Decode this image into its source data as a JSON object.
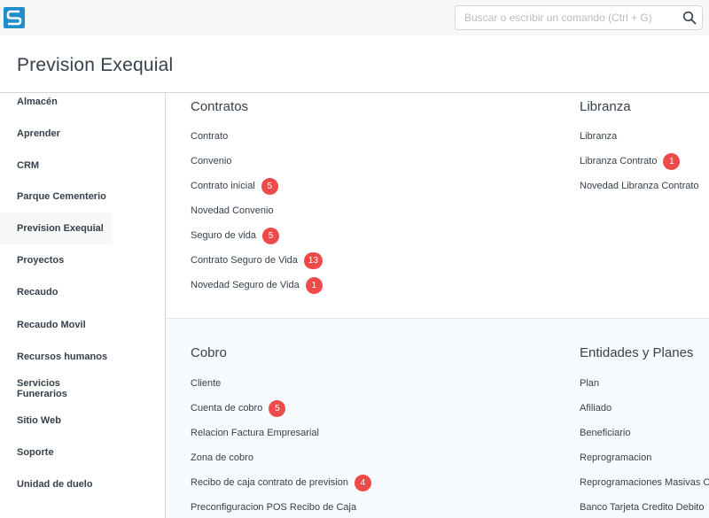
{
  "navbar": {
    "search_placeholder": "Buscar o escribir un comando (Ctrl + G)",
    "logo_icon": "app-logo-icon",
    "search_icon": "search-icon"
  },
  "page": {
    "title": "Prevision Exequial"
  },
  "sidebar": {
    "items": [
      {
        "label": "Almacén"
      },
      {
        "label": "Aprender"
      },
      {
        "label": "CRM"
      },
      {
        "label": "Parque Cementerio"
      },
      {
        "label": "Prevision Exequial"
      },
      {
        "label": "Proyectos"
      },
      {
        "label": "Recaudo"
      },
      {
        "label": "Recaudo Movil"
      },
      {
        "label": "Recursos humanos"
      },
      {
        "label": "Servicios Funerarios"
      },
      {
        "label": "Sitio Web"
      },
      {
        "label": "Soporte"
      },
      {
        "label": "Unidad de duelo"
      }
    ],
    "active": "Prevision Exequial"
  },
  "contratos": {
    "title": "Contratos",
    "links": [
      {
        "label": "Contrato",
        "badge": ""
      },
      {
        "label": "Convenio",
        "badge": ""
      },
      {
        "label": "Contrato inicial",
        "badge": "5"
      },
      {
        "label": "Novedad Convenio",
        "badge": ""
      },
      {
        "label": "Seguro de vida",
        "badge": "5"
      },
      {
        "label": "Contrato Seguro de Vida",
        "badge": "13"
      },
      {
        "label": "Novedad Seguro de Vida",
        "badge": "1"
      }
    ]
  },
  "libranza": {
    "title": "Libranza",
    "links": [
      {
        "label": "Libranza",
        "badge": ""
      },
      {
        "label": "Libranza Contrato",
        "badge": "1"
      },
      {
        "label": "Novedad Libranza Contrato",
        "badge": ""
      }
    ]
  },
  "cobro": {
    "title": "Cobro",
    "links": [
      {
        "label": "Cliente",
        "badge": ""
      },
      {
        "label": "Cuenta de cobro",
        "badge": "5"
      },
      {
        "label": "Relacion Factura Empresarial",
        "badge": ""
      },
      {
        "label": "Zona de cobro",
        "badge": ""
      },
      {
        "label": "Recibo de caja contrato de prevision",
        "badge": "4"
      },
      {
        "label": "Preconfiguracion POS Recibo de Caja",
        "badge": ""
      }
    ]
  },
  "entidades": {
    "title": "Entidades y Planes",
    "links": [
      {
        "label": "Plan",
        "badge": ""
      },
      {
        "label": "Afiliado",
        "badge": ""
      },
      {
        "label": "Beneficiario",
        "badge": ""
      },
      {
        "label": "Reprogramacion",
        "badge": ""
      },
      {
        "label": "Reprogramaciones Masivas C",
        "badge": ""
      },
      {
        "label": "Banco Tarjeta Credito Debito",
        "badge": ""
      }
    ]
  },
  "colors": {
    "accent_badge": "#ef4a4a",
    "text": "#36414c",
    "logo_blue": "#1f8ec9"
  }
}
